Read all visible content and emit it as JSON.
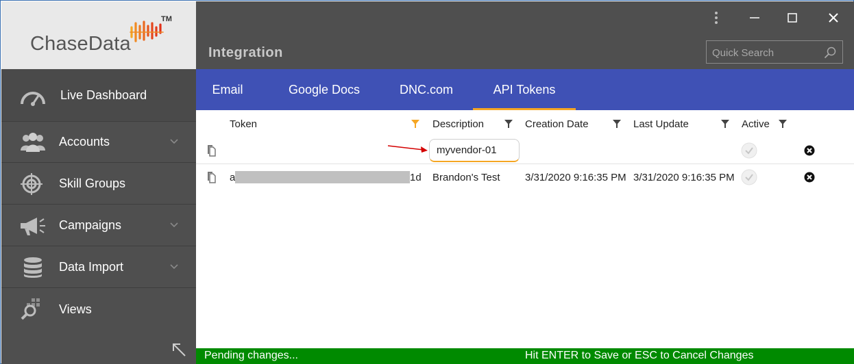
{
  "brand": {
    "name": "ChaseData",
    "trademark": "TM"
  },
  "header": {
    "title": "Integration"
  },
  "search": {
    "placeholder": "Quick Search"
  },
  "window_controls": [
    "more",
    "minimize",
    "maximize",
    "close"
  ],
  "sidebar": {
    "items": [
      {
        "label": "Live Dashboard",
        "icon": "speedometer-icon"
      },
      {
        "label": "Accounts",
        "icon": "users-icon",
        "expandable": true
      },
      {
        "label": "Skill Groups",
        "icon": "target-icon"
      },
      {
        "label": "Campaigns",
        "icon": "megaphone-icon",
        "expandable": true
      },
      {
        "label": "Data Import",
        "icon": "database-icon",
        "expandable": true
      },
      {
        "label": "Views",
        "icon": "search-grid-icon"
      }
    ]
  },
  "tabs": [
    {
      "label": "Email",
      "active": false
    },
    {
      "label": "Google Docs",
      "active": false
    },
    {
      "label": "DNC.com",
      "active": false
    },
    {
      "label": "API Tokens",
      "active": true
    }
  ],
  "grid": {
    "columns": [
      "Token",
      "Description",
      "Creation Date",
      "Last Update",
      "Active"
    ],
    "new_row": {
      "description": "myvendor-01"
    },
    "rows": [
      {
        "token_start": "a",
        "token_end": "1d",
        "description": "Brandon's Test",
        "creation_date": "3/31/2020 9:16:35 PM",
        "last_update": "3/31/2020 9:16:35 PM"
      }
    ]
  },
  "status": {
    "left": "Pending changes...",
    "right": "Hit ENTER to Save or ESC to Cancel Changes"
  },
  "colors": {
    "sidebar": "#4f4f4f",
    "tab_bar": "#3f51b5",
    "accent": "#f5a623",
    "status_bar": "#008a00",
    "annotation_arrow": "#d40000"
  }
}
